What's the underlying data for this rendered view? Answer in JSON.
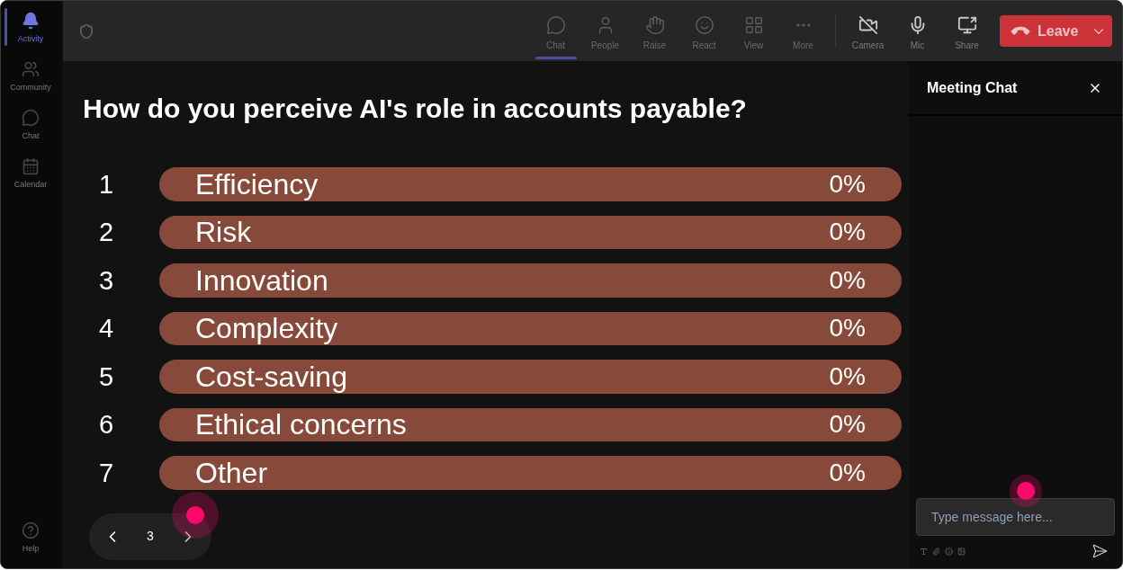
{
  "sidebar": {
    "items": [
      {
        "label": "Activity",
        "selected": true
      },
      {
        "label": "Community",
        "selected": false
      },
      {
        "label": "Chat",
        "selected": false
      },
      {
        "label": "Calendar",
        "selected": false
      }
    ],
    "help": {
      "label": "Help"
    }
  },
  "toolbar": {
    "actions": [
      {
        "label": "Chat",
        "selected": true
      },
      {
        "label": "People",
        "selected": false
      },
      {
        "label": "Raise",
        "selected": false
      },
      {
        "label": "React",
        "selected": false
      },
      {
        "label": "View",
        "selected": false
      },
      {
        "label": "More",
        "selected": false
      }
    ],
    "devices": [
      {
        "label": "Camera"
      },
      {
        "label": "Mic"
      },
      {
        "label": "Share"
      }
    ],
    "leave_button": {
      "label": "Leave"
    }
  },
  "poll": {
    "question": "How do you perceive AI's role in accounts payable?",
    "options": [
      {
        "number": "1",
        "label": "Efficiency",
        "percent": "0%"
      },
      {
        "number": "2",
        "label": "Risk",
        "percent": "0%"
      },
      {
        "number": "3",
        "label": "Innovation",
        "percent": "0%"
      },
      {
        "number": "4",
        "label": "Complexity",
        "percent": "0%"
      },
      {
        "number": "5",
        "label": "Cost-saving",
        "percent": "0%"
      },
      {
        "number": "6",
        "label": "Ethical concerns",
        "percent": "0%"
      },
      {
        "number": "7",
        "label": "Other",
        "percent": "0%"
      }
    ]
  },
  "pagination": {
    "page": "3"
  },
  "chat_panel": {
    "title": "Meeting Chat",
    "input": {
      "placeholder": "Type message here..."
    }
  }
}
